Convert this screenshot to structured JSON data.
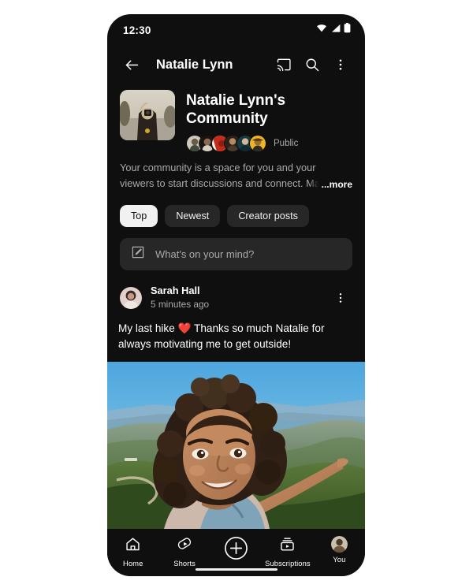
{
  "status_bar": {
    "time": "12:30",
    "icons": [
      "wifi-icon",
      "cellular-signal-icon",
      "battery-icon"
    ]
  },
  "app_bar": {
    "back_icon": "back-arrow-icon",
    "title": "Natalie Lynn",
    "cast_icon": "cast-icon",
    "search_icon": "search-icon",
    "overflow_icon": "more-vertical-icon"
  },
  "community": {
    "title": "Natalie Lynn's Community",
    "visibility": "Public",
    "member_count_shown": 6,
    "description": "Your community is a space for you and your viewers to start discussions and connect. Manage the",
    "more_label": "...more"
  },
  "chips": [
    {
      "label": "Top",
      "selected": true
    },
    {
      "label": "Newest",
      "selected": false
    },
    {
      "label": "Creator posts",
      "selected": false
    }
  ],
  "composer": {
    "icon": "compose-pencil-icon",
    "placeholder": "What's on your mind?"
  },
  "post": {
    "author": "Sarah Hall",
    "timestamp": "5 minutes ago",
    "overflow_icon": "more-vertical-icon",
    "text_before_emoji": "My last hike ",
    "emoji": "❤️",
    "text_after_emoji": " Thanks so much Natalie for always motivating me to get outside!"
  },
  "bottom_nav": [
    {
      "label": "Home",
      "icon": "home-icon"
    },
    {
      "label": "Shorts",
      "icon": "shorts-icon"
    },
    {
      "label": "",
      "icon": "create-plus-icon"
    },
    {
      "label": "Subscriptions",
      "icon": "subscriptions-icon"
    },
    {
      "label": "You",
      "icon": "account-avatar-icon"
    }
  ],
  "colors": {
    "background": "#0f0f0f",
    "chip_inactive": "#272727",
    "chip_active": "#f1f1f1",
    "secondary_text": "#aaaaaa",
    "heart_red": "#ff3b30",
    "page_background": "#ffffff"
  }
}
